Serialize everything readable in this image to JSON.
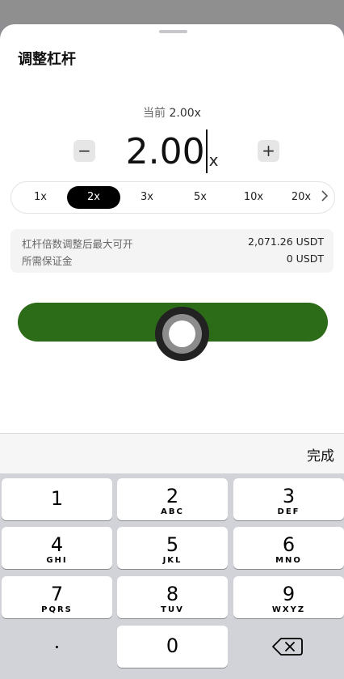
{
  "sheet": {
    "title": "调整杠杆",
    "current_label": "当前",
    "current_value": "2.00x"
  },
  "leverage": {
    "minus_label": "−",
    "plus_label": "+",
    "value": "2.00",
    "unit": "x"
  },
  "presets": {
    "items": [
      "1x",
      "2x",
      "3x",
      "5x",
      "10x",
      "20x"
    ],
    "active": "2x",
    "more_icon": "chevron-right-icon"
  },
  "info": {
    "max_open_label": "杠杆倍数调整后最大可开",
    "max_open_value": "2,071.26 USDT",
    "margin_label": "所需保证金",
    "margin_value": "0 USDT"
  },
  "confirm": {
    "color": "#2c6b18"
  },
  "keyboard": {
    "done_label": "完成",
    "keys": [
      {
        "digit": "1",
        "letters": ""
      },
      {
        "digit": "2",
        "letters": "ABC"
      },
      {
        "digit": "3",
        "letters": "DEF"
      },
      {
        "digit": "4",
        "letters": "GHI"
      },
      {
        "digit": "5",
        "letters": "JKL"
      },
      {
        "digit": "6",
        "letters": "MNO"
      },
      {
        "digit": "7",
        "letters": "PQRS"
      },
      {
        "digit": "8",
        "letters": "TUV"
      },
      {
        "digit": "9",
        "letters": "WXYZ"
      }
    ],
    "dot": ".",
    "zero": "0",
    "delete_icon": "backspace-icon"
  }
}
